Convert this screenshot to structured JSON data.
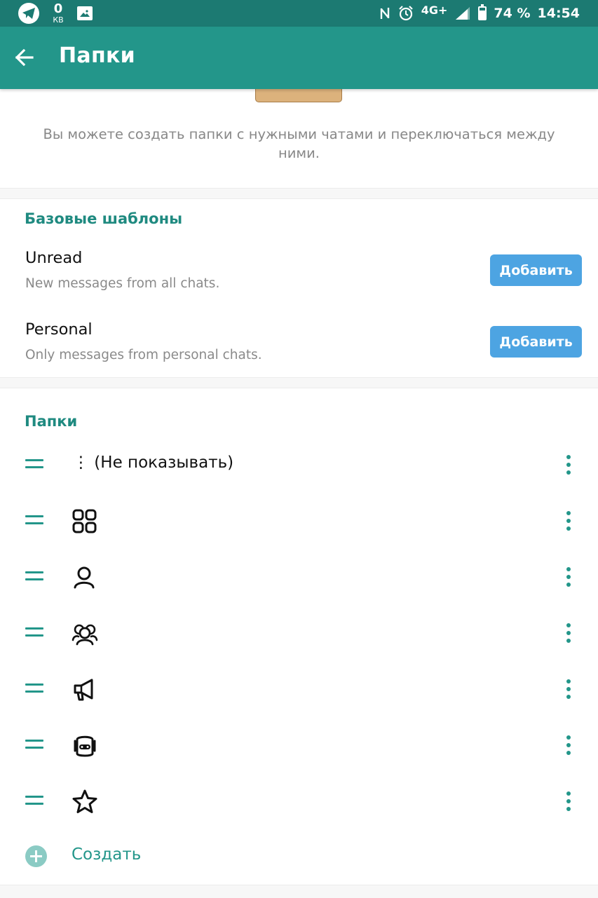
{
  "status_bar": {
    "kb_value": "0",
    "kb_unit": "КВ",
    "network": "4G+",
    "battery": "74 %",
    "time": "14:54"
  },
  "app_bar": {
    "title": "Папки",
    "back_icon": "arrow-left-icon"
  },
  "description": "Вы можете создать папки с нужными чатами и переключаться между ними.",
  "templates": {
    "header": "Базовые шаблоны",
    "items": [
      {
        "title": "Unread",
        "subtitle": "New messages from all chats.",
        "button": "Добавить"
      },
      {
        "title": "Personal",
        "subtitle": "Only messages from personal chats.",
        "button": "Добавить"
      }
    ]
  },
  "folders": {
    "header": "Папки",
    "items": [
      {
        "name": "⋮ (Не показывать)",
        "icon": ""
      },
      {
        "name": "",
        "icon": "grid-icon"
      },
      {
        "name": "",
        "icon": "person-icon"
      },
      {
        "name": "",
        "icon": "group-icon"
      },
      {
        "name": "",
        "icon": "megaphone-icon"
      },
      {
        "name": "",
        "icon": "bot-icon"
      },
      {
        "name": "",
        "icon": "star-icon"
      }
    ],
    "create_label": "Создать"
  },
  "colors": {
    "status_bar": "#1c7a72",
    "app_bar": "#23968a",
    "accent": "#23968a",
    "add_button": "#4da4e2"
  }
}
